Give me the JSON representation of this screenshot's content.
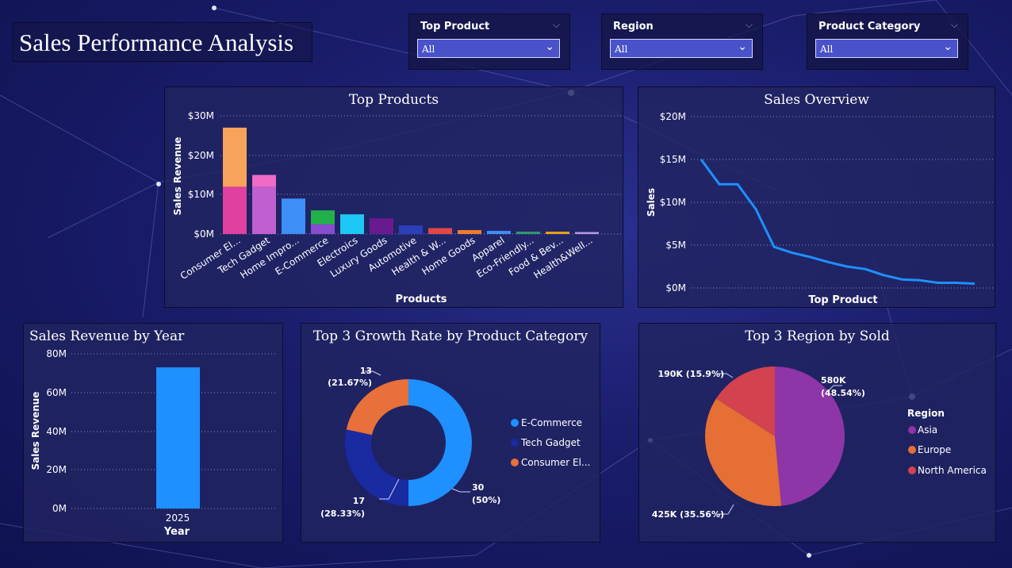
{
  "title": "Sales Performance Analysis",
  "slicers": [
    {
      "label": "Top Product",
      "value": "All"
    },
    {
      "label": "Region",
      "value": "All"
    },
    {
      "label": "Product Category",
      "value": "All"
    }
  ],
  "top_products": {
    "title": "Top Products",
    "xlabel": "Products",
    "ylabel": "Sales Revenue",
    "yticks": [
      "$0M",
      "$10M",
      "$20M",
      "$30M"
    ]
  },
  "sales_overview": {
    "title": "Sales Overview",
    "xlabel": "Top Product",
    "ylabel": "Sales",
    "yticks": [
      "$0M",
      "$5M",
      "$10M",
      "$15M",
      "$20M"
    ]
  },
  "revenue_by_year": {
    "title": "Sales Revenue by Year",
    "xlabel": "Year",
    "ylabel": "Sales Revenue",
    "yticks": [
      "0M",
      "20M",
      "40M",
      "60M",
      "80M"
    ],
    "category": "2025"
  },
  "growth_rate": {
    "title": "Top 3 Growth Rate by Product Category",
    "labels": [
      {
        "value": "30",
        "pct": "(50%)"
      },
      {
        "value": "17",
        "pct": "(28.33%)"
      },
      {
        "value": "13",
        "pct": "(21.67%)"
      }
    ],
    "legend": [
      "E-Commerce",
      "Tech Gadget",
      "Consumer El..."
    ]
  },
  "region_sold": {
    "title": "Top 3 Region by Sold",
    "legend_title": "Region",
    "legend": [
      "Asia",
      "Europe",
      "North America"
    ],
    "labels": [
      {
        "value": "580K",
        "pct": "(48.54%)"
      },
      {
        "value": "425K (35.56%)"
      },
      {
        "value": "190K (15.9%)"
      }
    ]
  },
  "chart_data": [
    {
      "type": "bar",
      "title": "Top Products",
      "xlabel": "Products",
      "ylabel": "Sales Revenue",
      "ylim": [
        0,
        30
      ],
      "categories": [
        "Consumer El...",
        "Tech Gadget",
        "Home Impro...",
        "E-Commerce",
        "Electroics",
        "Luxury Goods",
        "Automotive",
        "Health & W...",
        "Home Goods",
        "Apparel",
        "Eco-Friendly...",
        "Food & Bev...",
        "Health&Well..."
      ],
      "stacks": [
        [
          {
            "value": 12.0,
            "color": "#e040a0"
          },
          {
            "value": 15.0,
            "color": "#f7a35c"
          }
        ],
        [
          {
            "value": 12.0,
            "color": "#c05fd0"
          },
          {
            "value": 3.0,
            "color": "#f06ac8"
          }
        ],
        [
          {
            "value": 9.0,
            "color": "#3d8ef7"
          }
        ],
        [
          {
            "value": 2.5,
            "color": "#8a4ccf"
          },
          {
            "value": 3.5,
            "color": "#22b04a"
          }
        ],
        [
          {
            "value": 5.0,
            "color": "#1cc8f5"
          }
        ],
        [
          {
            "value": 4.0,
            "color": "#6a1a8f"
          }
        ],
        [
          {
            "value": 2.2,
            "color": "#2a3fb8"
          }
        ],
        [
          {
            "value": 1.5,
            "color": "#e04848"
          }
        ],
        [
          {
            "value": 1.0,
            "color": "#f07a2e"
          }
        ],
        [
          {
            "value": 0.8,
            "color": "#3d8ef7"
          }
        ],
        [
          {
            "value": 0.6,
            "color": "#2f9a6a"
          }
        ],
        [
          {
            "value": 0.6,
            "color": "#e8a01a"
          }
        ],
        [
          {
            "value": 0.5,
            "color": "#b898e8"
          }
        ]
      ]
    },
    {
      "type": "line",
      "title": "Sales Overview",
      "xlabel": "Top Product",
      "ylabel": "Sales",
      "ylim": [
        0,
        20
      ],
      "values": [
        15.0,
        12.1,
        12.1,
        9.2,
        4.8,
        4.1,
        3.6,
        3.0,
        2.5,
        2.2,
        1.5,
        1.0,
        0.9,
        0.6,
        0.6,
        0.5
      ],
      "color": "#1e90ff"
    },
    {
      "type": "bar",
      "title": "Sales Revenue by Year",
      "xlabel": "Year",
      "ylabel": "Sales Revenue",
      "ylim": [
        0,
        80
      ],
      "categories": [
        "2025"
      ],
      "values": [
        73
      ],
      "color": "#1e90ff"
    },
    {
      "type": "pie",
      "title": "Top 3 Growth Rate by Product Category",
      "donut": true,
      "categories": [
        "E-Commerce",
        "Tech Gadget",
        "Consumer El..."
      ],
      "values": [
        30,
        17,
        13
      ],
      "colors": [
        "#1e90ff",
        "#1a2aa0",
        "#e8703a"
      ]
    },
    {
      "type": "pie",
      "title": "Top 3 Region by Sold",
      "categories": [
        "Asia",
        "Europe",
        "North America"
      ],
      "values": [
        580,
        425,
        190
      ],
      "colors": [
        "#8e35a8",
        "#e56f35",
        "#d2434f"
      ]
    }
  ]
}
